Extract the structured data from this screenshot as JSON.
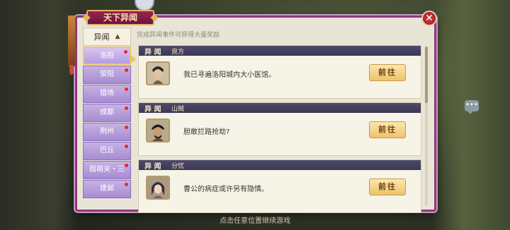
{
  "window": {
    "title": "天下异闻",
    "close_icon": "close-icon"
  },
  "hint": "完成异闻事件可获得大量奖励",
  "sidebar": {
    "category": "异闻",
    "category_icon": "caret-up-icon",
    "items": [
      {
        "label": "洛阳",
        "active": true
      },
      {
        "label": "荥阳"
      },
      {
        "label": "猎场"
      },
      {
        "label": "成都"
      },
      {
        "label": "荆州"
      },
      {
        "label": "巴丘"
      },
      {
        "label": "葭萌关・三"
      },
      {
        "label": "建邺"
      }
    ]
  },
  "events": [
    {
      "tag": "异 闻",
      "title": "良方",
      "text": "我已寻遍洛阳城内大小医馆。",
      "button": "前往"
    },
    {
      "tag": "异 闻",
      "title": "山贼",
      "text": "胆敢拦路抢劫?",
      "button": "前往"
    },
    {
      "tag": "异 闻",
      "title": "分忧",
      "text": "曹公的病症或许另有隐情。",
      "button": "前往"
    }
  ],
  "footer_hint": "点击任意位置继续游戏",
  "colors": {
    "panel_border": "#8e3a7c",
    "sidebar_item": "#b79ce0",
    "card_header": "#4e4a6c",
    "button": "#eec36a",
    "badge_dot": "#e02a2a"
  }
}
